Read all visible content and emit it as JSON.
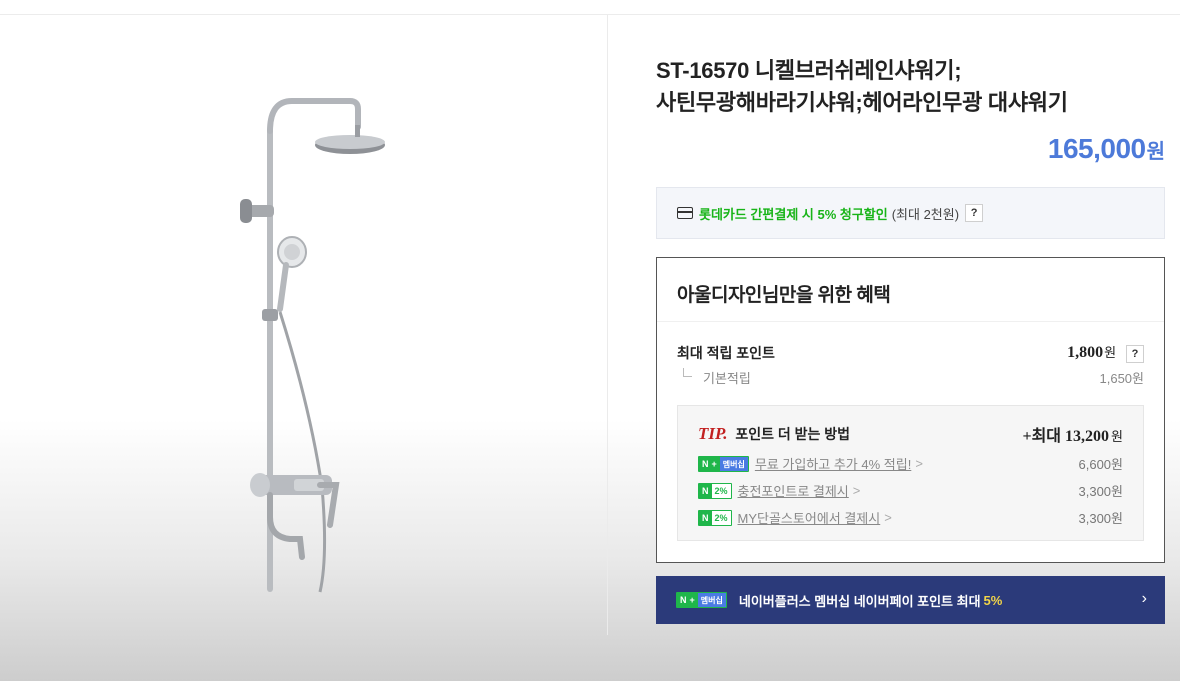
{
  "product": {
    "title_line1": "ST-16570 니켈브러쉬레인샤워기;",
    "title_line2": "사틴무광해바라기샤워;헤어라인무광 대샤워기",
    "price": "165,000",
    "price_unit": "원",
    "image_icon": "shower-fixture-image"
  },
  "card_discount": {
    "icon": "credit-card-icon",
    "highlight": "롯데카드 간편결제 시 5% 청구할인",
    "note": "(최대 2천원)",
    "help": "?"
  },
  "benefits": {
    "heading": "아울디자인님만을 위한 혜택",
    "max_points_label": "최대 적립 포인트",
    "max_points_value": "1,800",
    "max_points_unit": "원",
    "help": "?",
    "basic_label": "기본적립",
    "basic_value": "1,650원",
    "tip": {
      "tip_word": "TIP.",
      "heading": "포인트 더 받는 방법",
      "total_prefix": "+최대",
      "total_value": "13,200",
      "total_unit": "원",
      "rows": [
        {
          "badge_n": "N",
          "badge_extra": "+",
          "badge_mem": "멤버십",
          "text": "무료 가입하고 추가 4% 적립!",
          "arrow": ">",
          "value": "6,600원"
        },
        {
          "badge_n": "N",
          "badge_extra": "2%",
          "text": "충전포인트로 결제시",
          "arrow": ">",
          "value": "3,300원"
        },
        {
          "badge_n": "N",
          "badge_extra": "2%",
          "text": "MY단골스토어에서 결제시",
          "arrow": ">",
          "value": "3,300원"
        }
      ]
    }
  },
  "naver_plus": {
    "badge_n": "N",
    "badge_plus": "+",
    "badge_mem": "멤버십",
    "text": "네이버플러스 멤버십 네이버페이 포인트 최대",
    "highlight": "5%",
    "chevron": "›"
  },
  "colors": {
    "price": "#4d7ad9",
    "discount_green": "#18b418",
    "tip_red": "#c22020",
    "naver_bar": "#2b3a7a",
    "naver_highlight": "#f2d548"
  }
}
